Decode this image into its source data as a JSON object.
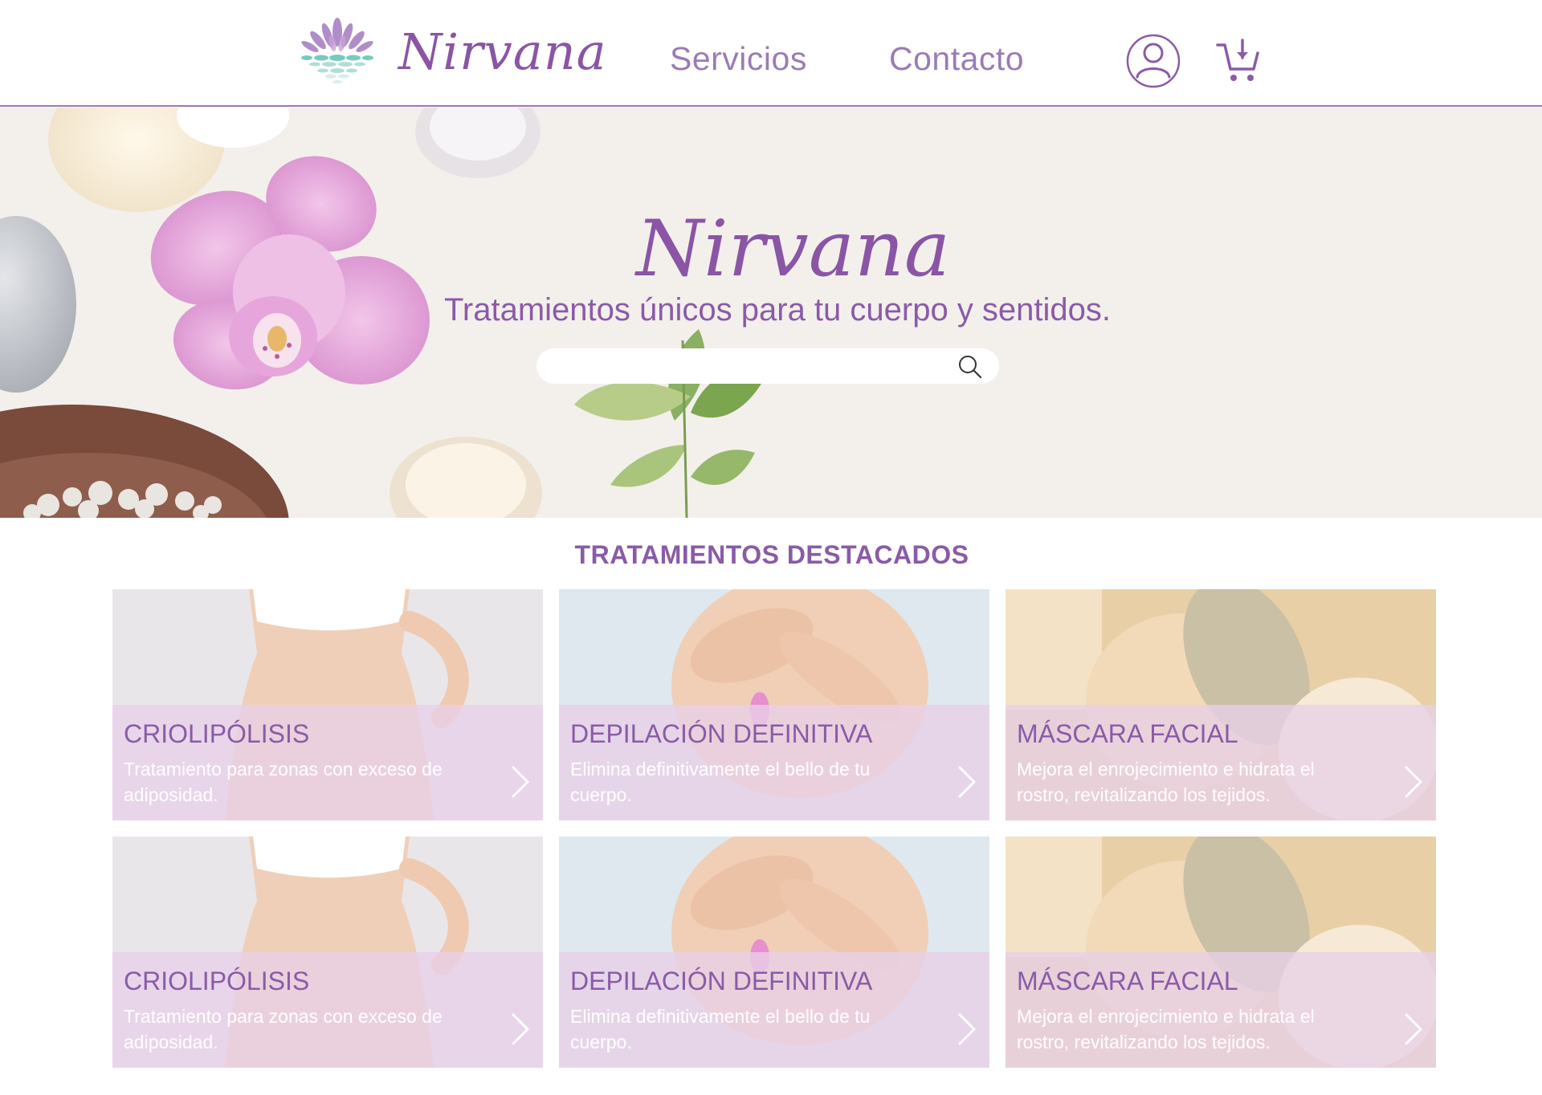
{
  "brand": {
    "name": "Nirvana"
  },
  "nav": {
    "servicios": "Servicios",
    "contacto": "Contacto"
  },
  "icons": {
    "user": "user-icon",
    "cart": "cart-icon",
    "search": "search-icon",
    "chevron": "chevron-right-icon",
    "logo": "lotus-logo-icon"
  },
  "hero": {
    "title": "Nirvana",
    "subtitle": "Tratamientos únicos para tu cuerpo y sentidos.",
    "search_placeholder": ""
  },
  "section": {
    "title": "TRATAMIENTOS DESTACADOS"
  },
  "cards": [
    {
      "title": "CRIOLIPÓLISIS",
      "desc": "Tratamiento para zonas con exceso de adiposidad.",
      "scene": "body"
    },
    {
      "title": "DEPILACIÓN DEFINITIVA",
      "desc": "Elimina definitivamente el bello de tu cuerpo.",
      "scene": "legs"
    },
    {
      "title": "MÁSCARA FACIAL",
      "desc": "Mejora el enrojecimiento e hidrata el rostro, revitalizando los tejidos.",
      "scene": "face"
    },
    {
      "title": "CRIOLIPÓLISIS",
      "desc": "Tratamiento para zonas con exceso de adiposidad.",
      "scene": "body"
    },
    {
      "title": "DEPILACIÓN DEFINITIVA",
      "desc": "Elimina definitivamente el bello de tu cuerpo.",
      "scene": "legs"
    },
    {
      "title": "MÁSCARA FACIAL",
      "desc": "Mejora el enrojecimiento e hidrata el rostro, revitalizando los tejidos.",
      "scene": "face"
    }
  ],
  "colors": {
    "primary": "#8b55a6",
    "accent": "#9a7cb4",
    "overlay": "#e8d0e8"
  }
}
